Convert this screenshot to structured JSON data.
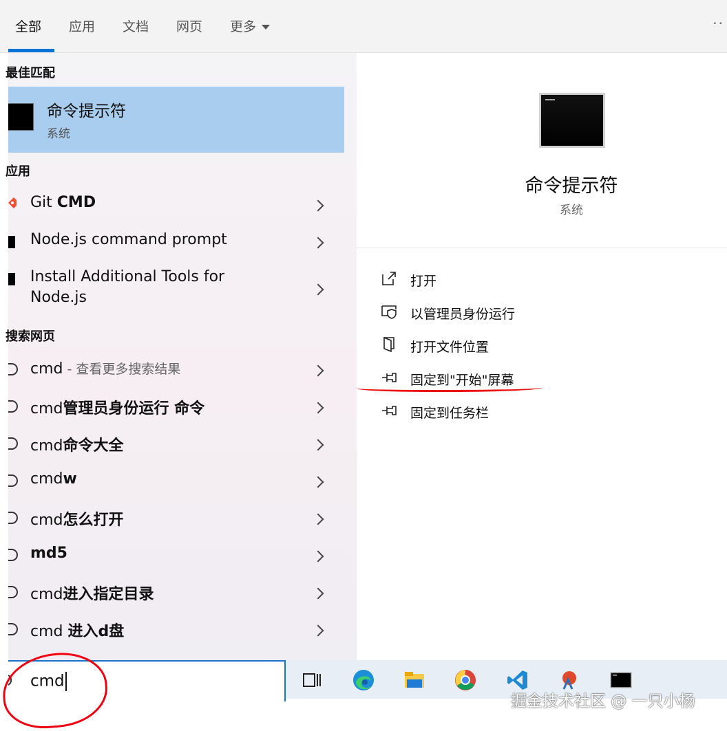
{
  "tabs": [
    {
      "label": "全部"
    },
    {
      "label": "应用"
    },
    {
      "label": "文档"
    },
    {
      "label": "网页"
    },
    {
      "label": "更多"
    }
  ],
  "more_menu_icon": "ellipsis-icon",
  "left_panel": {
    "best_match_heading": "最佳匹配",
    "best_match": {
      "title": "命令提示符",
      "subtitle": "系统"
    },
    "apps_heading": "应用",
    "apps": [
      {
        "plain": "Git ",
        "bold": "CMD"
      },
      {
        "plain": "Node.js command prompt",
        "bold": ""
      },
      {
        "line1": "Install Additional Tools for",
        "line2": "Node.js"
      }
    ],
    "web_heading": "搜索网页",
    "web": [
      {
        "plain": "cmd",
        "bold": "",
        "hint": " - 查看更多搜索结果"
      },
      {
        "plain": "cmd",
        "bold": "管理员身份运行 命令",
        "hint": ""
      },
      {
        "plain": "cmd",
        "bold": "命令大全",
        "hint": ""
      },
      {
        "plain": "cmd",
        "bold": "w",
        "hint": ""
      },
      {
        "plain": "cmd",
        "bold": "怎么打开",
        "hint": ""
      },
      {
        "plain": "",
        "bold": "md5",
        "hint": ""
      },
      {
        "plain": "cmd",
        "bold": "进入指定目录",
        "hint": ""
      },
      {
        "plain": "cmd ",
        "bold": "进入d盘",
        "hint": ""
      }
    ]
  },
  "preview": {
    "title": "命令提示符",
    "subtitle": "系统",
    "actions": [
      {
        "label": "打开",
        "icon": "open-icon"
      },
      {
        "label": "以管理员身份运行",
        "icon": "shield-icon"
      },
      {
        "label": "打开文件位置",
        "icon": "file-location-icon"
      },
      {
        "label": "固定到\"开始\"屏幕",
        "icon": "pin-icon"
      },
      {
        "label": "固定到任务栏",
        "icon": "pin-icon"
      }
    ]
  },
  "search": {
    "value": "cmd"
  },
  "taskbar": [
    "task-view-icon",
    "edge-icon",
    "file-explorer-icon",
    "chrome-icon",
    "vscode-icon",
    "app-icon",
    "cmd-icon"
  ],
  "watermark": "掘金技术社区 @ 一只小杨",
  "colors": {
    "accent": "#0a74d6",
    "selected": "#a9cdef",
    "annotation": "#e11111"
  }
}
